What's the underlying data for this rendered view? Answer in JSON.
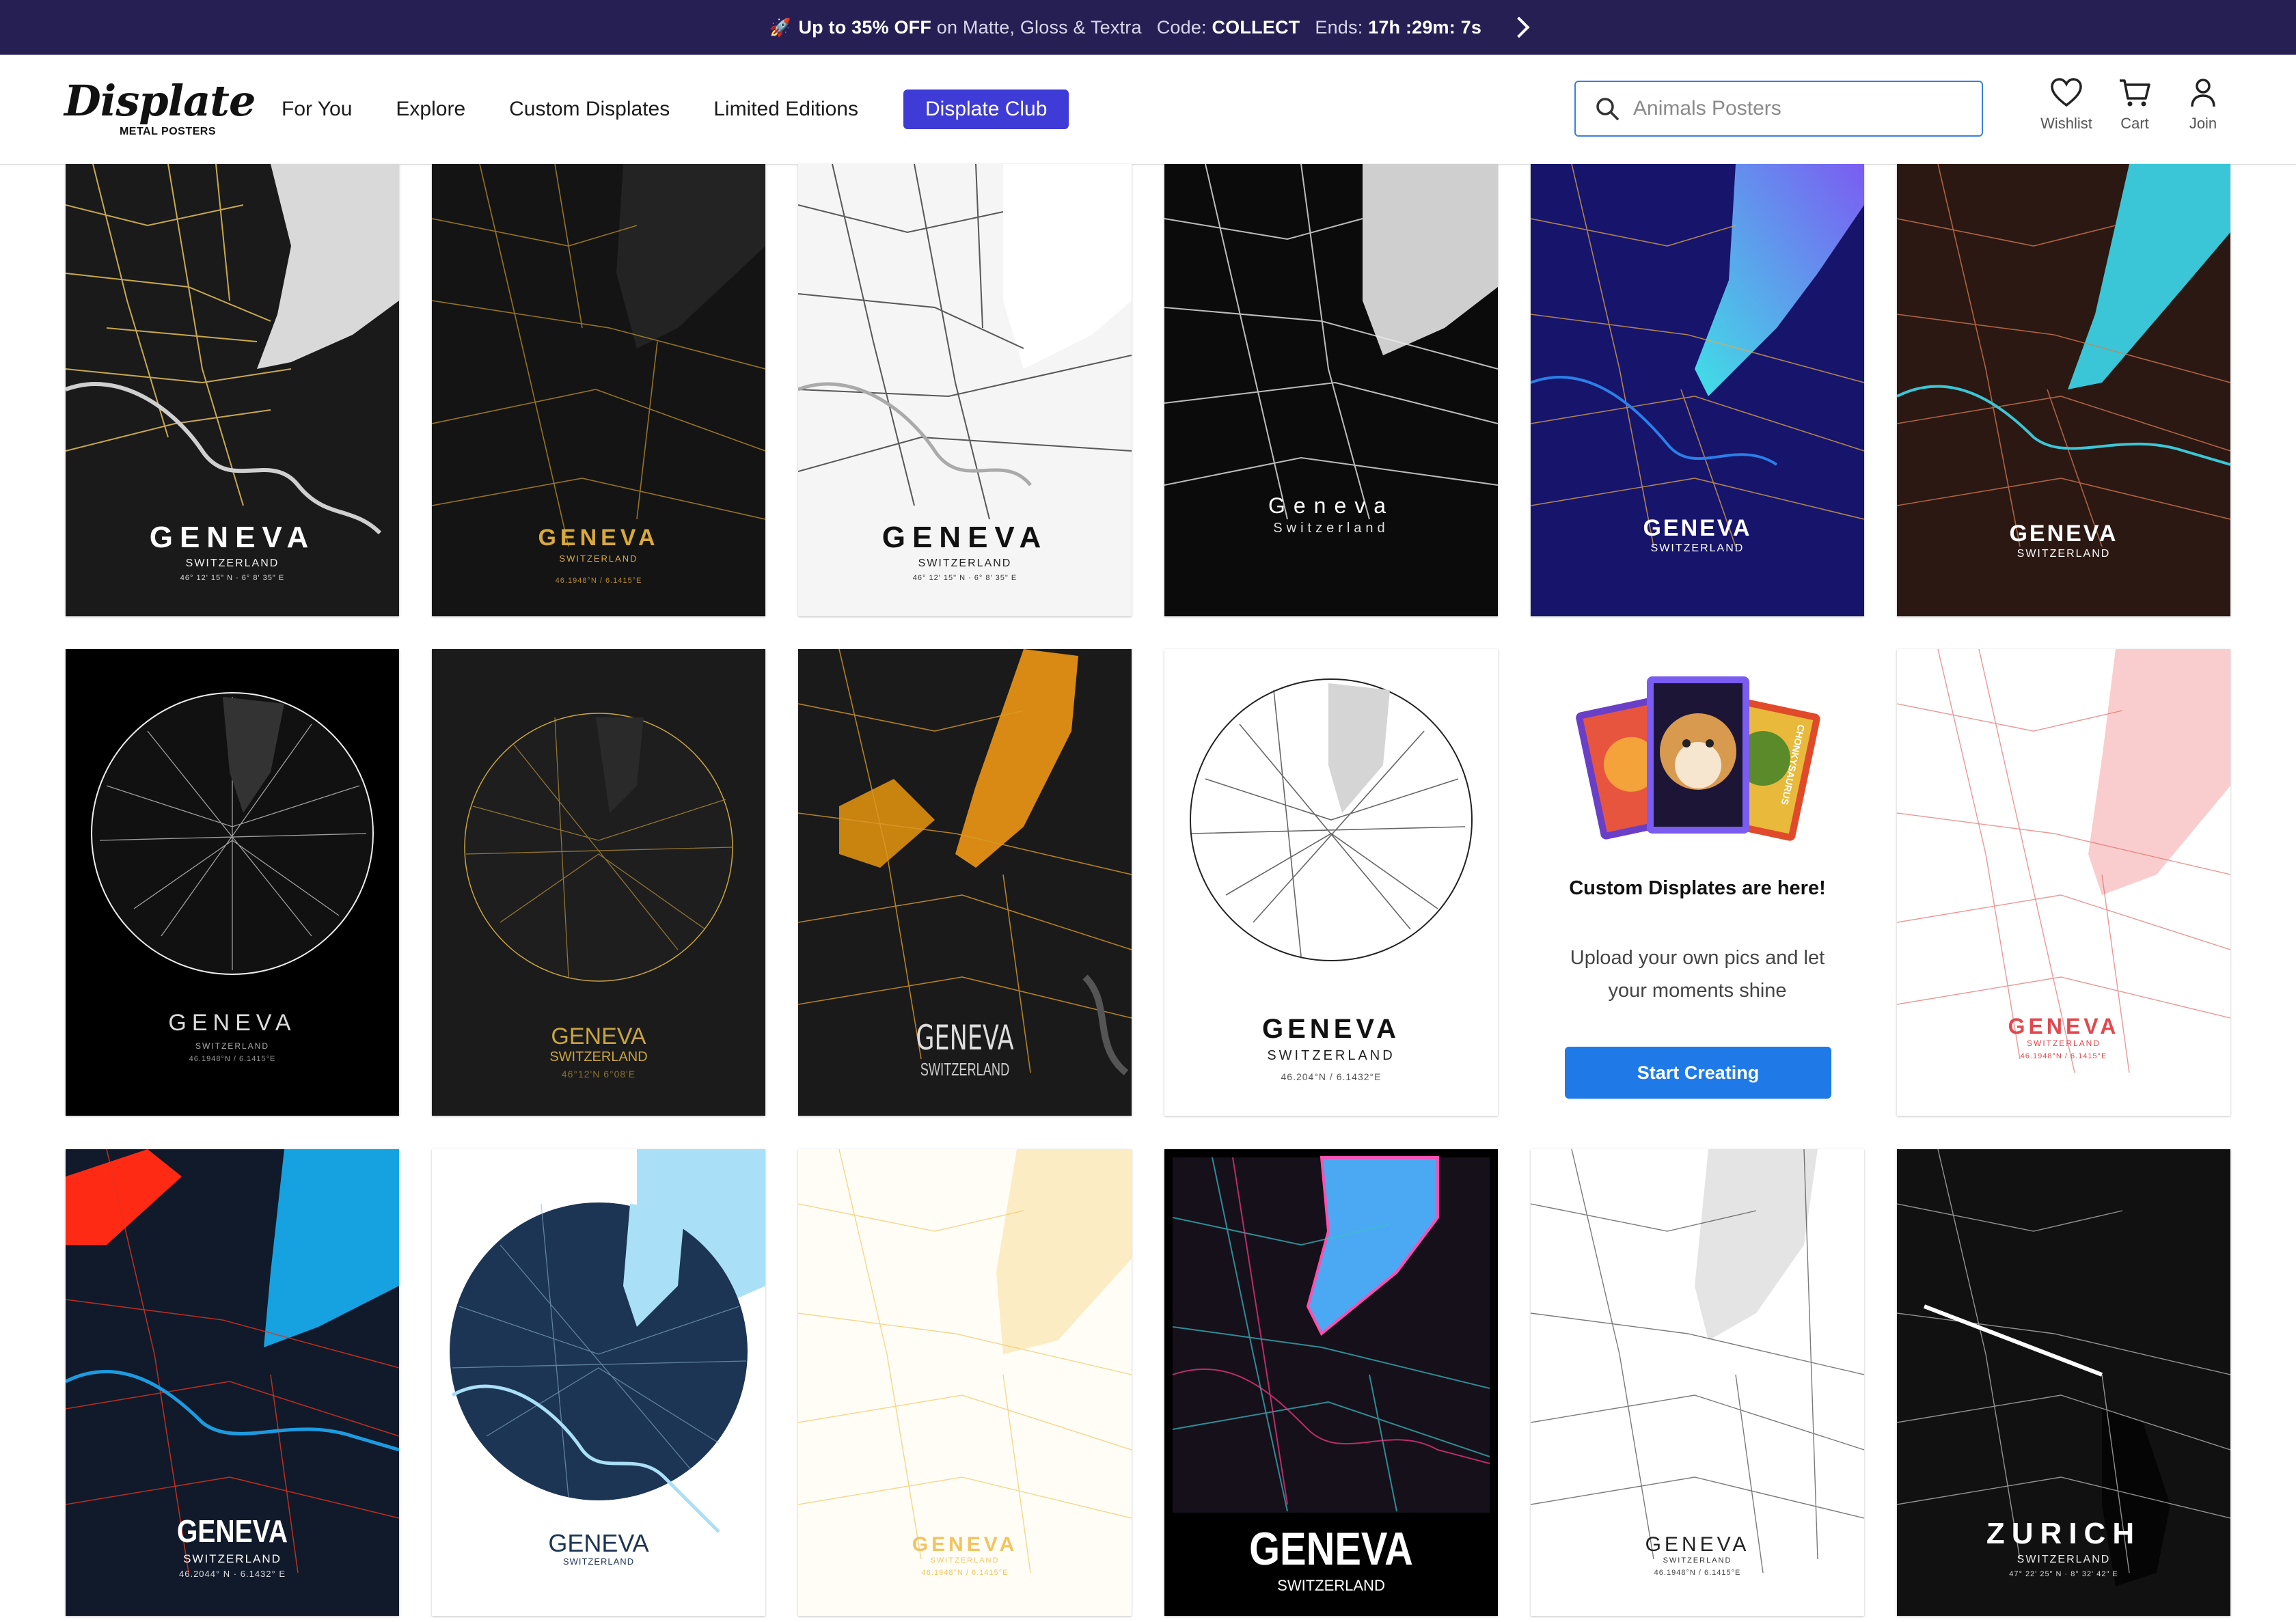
{
  "promo_bar": {
    "rocket": "🚀",
    "headline": "Up to 35% OFF",
    "detail": "on Matte, Gloss & Textra",
    "code_label": "Code:",
    "code": "COLLECT",
    "ends_label": "Ends:",
    "hours": "17h",
    "minutes": ":29m",
    "seconds": ": 7s"
  },
  "logo": {
    "word": "Displate",
    "tagline": "METAL POSTERS"
  },
  "nav": {
    "items": [
      "For You",
      "Explore",
      "Custom Displates",
      "Limited Editions"
    ],
    "club": "Displate Club"
  },
  "search": {
    "placeholder": "Animals Posters"
  },
  "user_menu": {
    "wishlist": "Wishlist",
    "cart": "Cart",
    "join": "Join"
  },
  "posters": [
    {
      "title": "GENEVA",
      "subtitle": "SWITZERLAND",
      "coords": "46° 12' 15\" N · 6° 8' 35\" E"
    },
    {
      "title": "GENEVA",
      "subtitle": "SWITZERLAND",
      "coords": "46.1948°N / 6.1415°E"
    },
    {
      "title": "GENEVA",
      "subtitle": "SWITZERLAND",
      "coords": "46° 12' 15\" N · 6° 8' 35\" E"
    },
    {
      "title": "Geneva",
      "subtitle": "Switzerland",
      "coords": ""
    },
    {
      "title": "GENEVA",
      "subtitle": "SWITZERLAND",
      "coords": ""
    },
    {
      "title": "GENEVA",
      "subtitle": "SWITZERLAND",
      "coords": ""
    },
    {
      "title": "GENEVA",
      "subtitle": "SWITZERLAND",
      "coords": "46.1948°N / 6.1415°E"
    },
    {
      "title": "GENEVA",
      "subtitle": "SWITZERLAND",
      "coords": "46°12'N 6°08'E"
    },
    {
      "title": "GENEVA",
      "subtitle": "SWITZERLAND",
      "coords": ""
    },
    {
      "title": "GENEVA",
      "subtitle": "SWITZERLAND",
      "coords": "46.204°N / 6.1432°E"
    },
    {
      "title": "GENEVA",
      "subtitle": "SWITZERLAND",
      "coords": "46.1948°N / 6.1415°E"
    },
    {
      "title": "GENEVA",
      "subtitle": "SWITZERLAND",
      "coords": "46.2044° N · 6.1432° E"
    },
    {
      "title": "GENEVA",
      "subtitle": "SWITZERLAND",
      "coords": ""
    },
    {
      "title": "GENEVA",
      "subtitle": "SWITZERLAND",
      "coords": "46.1948°N / 6.1415°E"
    },
    {
      "title": "GENEVA",
      "subtitle": "SWITZERLAND",
      "coords": ""
    },
    {
      "title": "GENEVA",
      "subtitle": "SWITZERLAND",
      "coords": "46.1948°N / 6.1415°E"
    },
    {
      "title": "ZURICH",
      "subtitle": "SWITZERLAND",
      "coords": "47° 22' 25\" N · 8° 32' 42\" E"
    }
  ],
  "promo_card": {
    "title": "Custom Displates are here!",
    "text": "Upload your own pics and let your moments shine",
    "button": "Start Creating",
    "sticker_text": "CHONKYSAURUS"
  },
  "colors": {
    "promo_bg": "#251f54",
    "club": "#3f3bd6",
    "cta": "#1f7ae8"
  }
}
